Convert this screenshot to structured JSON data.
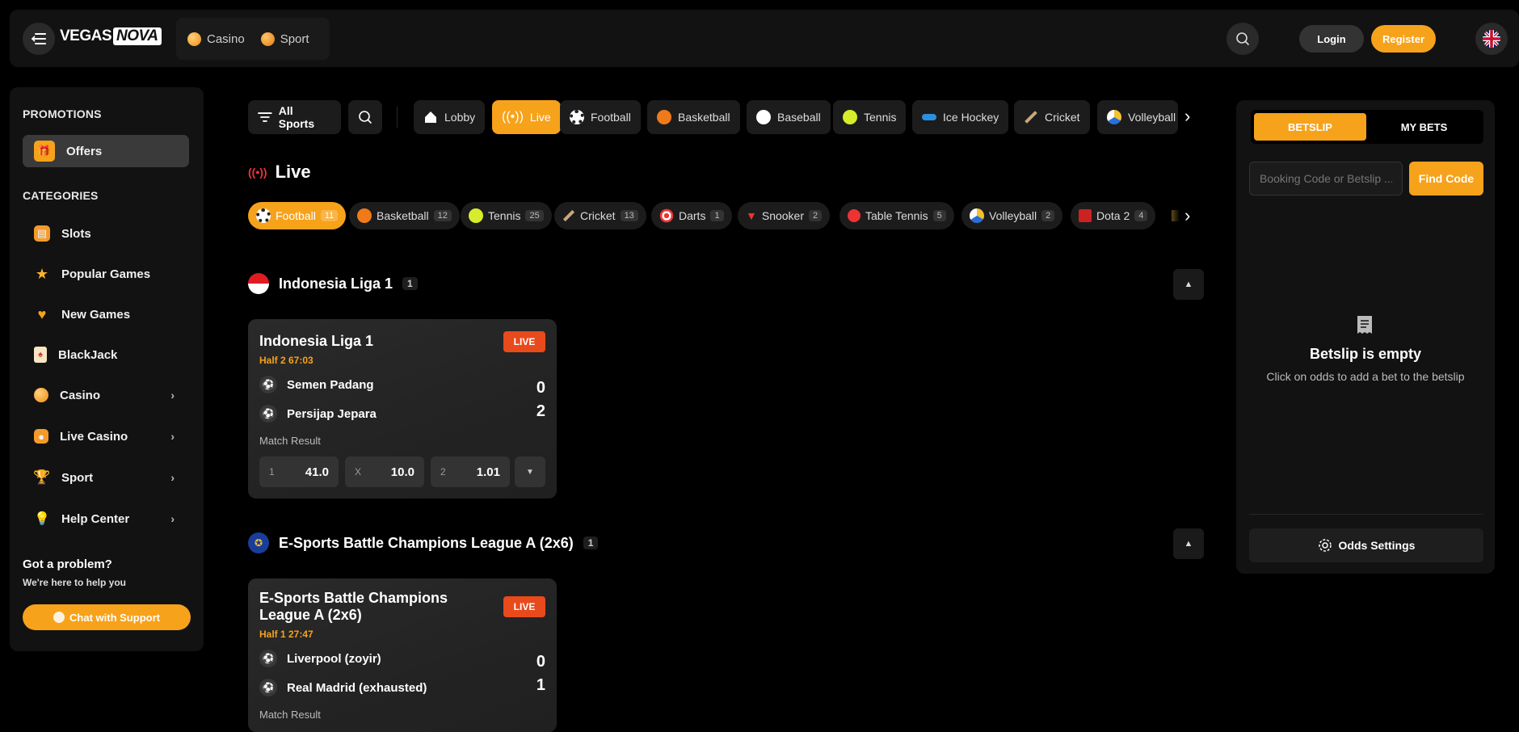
{
  "header": {
    "logo_part1": "VEGAS",
    "logo_part2": "NOVA",
    "nav": [
      {
        "label": "Casino",
        "icon": "casino-coin-icon"
      },
      {
        "label": "Sport",
        "icon": "sport-coin-icon"
      }
    ],
    "login_label": "Login",
    "register_label": "Register",
    "accent_color": "#f7a21b"
  },
  "sidebar": {
    "promotions_heading": "PROMOTIONS",
    "offers_label": "Offers",
    "categories_heading": "CATEGORIES",
    "items": [
      {
        "label": "Slots",
        "has_submenu": false
      },
      {
        "label": "Popular Games",
        "has_submenu": false
      },
      {
        "label": "New Games",
        "has_submenu": false
      },
      {
        "label": "BlackJack",
        "has_submenu": false
      },
      {
        "label": "Casino",
        "has_submenu": true
      },
      {
        "label": "Live Casino",
        "has_submenu": true
      },
      {
        "label": "Sport",
        "has_submenu": true
      },
      {
        "label": "Help Center",
        "has_submenu": true
      }
    ],
    "help_title": "Got a problem?",
    "help_subtitle": "We're here to help you",
    "chat_label": "Chat with Support"
  },
  "sport_nav": {
    "all_sports_label": "All Sports",
    "tabs": [
      "Lobby",
      "Live",
      "Football",
      "Basketball",
      "Baseball",
      "Tennis",
      "Ice Hockey",
      "Cricket",
      "Volleyball"
    ],
    "active_tab": "Live"
  },
  "live": {
    "title": "Live",
    "chips": [
      {
        "label": "Football",
        "count": "11"
      },
      {
        "label": "Basketball",
        "count": "12"
      },
      {
        "label": "Tennis",
        "count": "25"
      },
      {
        "label": "Cricket",
        "count": "13"
      },
      {
        "label": "Darts",
        "count": "1"
      },
      {
        "label": "Snooker",
        "count": "2"
      },
      {
        "label": "Table Tennis",
        "count": "5"
      },
      {
        "label": "Volleyball",
        "count": "2"
      },
      {
        "label": "Dota 2",
        "count": "4"
      }
    ]
  },
  "leagues": [
    {
      "name": "Indonesia Liga 1",
      "count": "1",
      "match": {
        "title": "Indonesia Liga 1",
        "badge": "LIVE",
        "time": "Half 2 67:03",
        "home": "Semen Padang",
        "away": "Persijap Jepara",
        "home_score": "0",
        "away_score": "2",
        "market": "Match Result",
        "odds": [
          {
            "label": "1",
            "value": "41.0"
          },
          {
            "label": "X",
            "value": "10.0"
          },
          {
            "label": "2",
            "value": "1.01"
          }
        ]
      }
    },
    {
      "name": "E-Sports Battle Champions League A (2x6)",
      "count": "1",
      "match": {
        "title": "E-Sports Battle Champions League A (2x6)",
        "badge": "LIVE",
        "time": "Half 1 27:47",
        "home": "Liverpool (zoyir)",
        "away": "Real Madrid (exhausted)",
        "home_score": "0",
        "away_score": "1",
        "market": "Match Result"
      }
    }
  ],
  "betslip": {
    "tab_betslip": "BETSLIP",
    "tab_mybets": "MY BETS",
    "code_placeholder": "Booking Code or Betslip ...",
    "find_label": "Find Code",
    "empty_title": "Betslip is empty",
    "empty_subtitle": "Click on odds to add a bet to the betslip",
    "odds_settings_label": "Odds Settings"
  }
}
